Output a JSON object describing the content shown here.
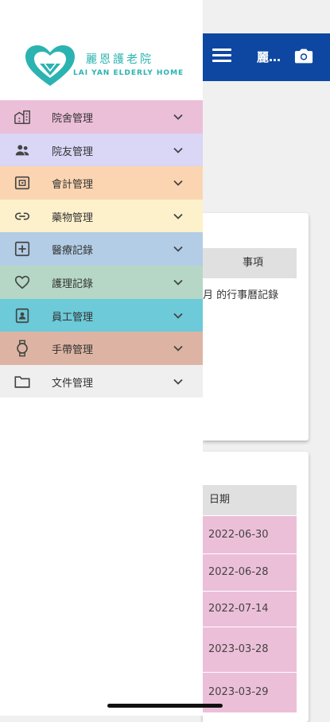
{
  "app": {
    "title": "麗…",
    "colors": {
      "appbar": "#0d47a1",
      "date_row": "#ecbfd9",
      "header": "#e0e0e0"
    }
  },
  "logo": {
    "name_zh": "麗恩護老院",
    "name_en": "LAI YAN ELDERLY HOME"
  },
  "menu": {
    "items": [
      {
        "label": "院舍管理",
        "icon": "building-icon",
        "color": "#ecbfd9"
      },
      {
        "label": "院友管理",
        "icon": "people-icon",
        "color": "#d9d6f6"
      },
      {
        "label": "會計管理",
        "icon": "wallet-icon",
        "color": "#fbd5b1"
      },
      {
        "label": "藥物管理",
        "icon": "link-icon",
        "color": "#fdf1cc"
      },
      {
        "label": "醫療記錄",
        "icon": "medical-plus-icon",
        "color": "#b3cde6"
      },
      {
        "label": "護理記錄",
        "icon": "heart-icon",
        "color": "#b6d7c6"
      },
      {
        "label": "員工管理",
        "icon": "badge-icon",
        "color": "#6ccad9"
      },
      {
        "label": "手帶管理",
        "icon": "watch-icon",
        "color": "#ddb4a3"
      },
      {
        "label": "文件管理",
        "icon": "folder-icon",
        "color": "#efefef"
      }
    ]
  },
  "events": {
    "header": "事項",
    "text": "月 的行事曆記錄"
  },
  "dates": {
    "header": "日期",
    "rows": [
      "2022-06-30",
      "2022-06-28",
      "2022-07-14",
      "2023-03-28",
      "2023-03-29"
    ]
  }
}
